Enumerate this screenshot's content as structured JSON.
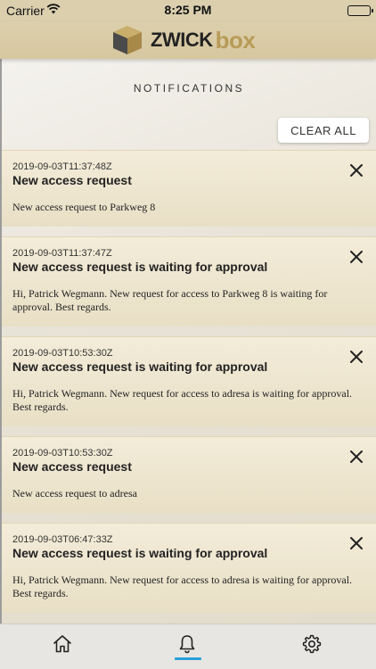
{
  "status_bar": {
    "carrier": "Carrier",
    "time": "8:25 PM",
    "battery_level": 1.0
  },
  "header": {
    "brand_left": "ZWICK",
    "brand_right": "box"
  },
  "page": {
    "title": "NOTIFICATIONS",
    "clear_all_label": "CLEAR ALL"
  },
  "notifications": [
    {
      "timestamp": "2019-09-03T11:37:48Z",
      "title": "New access request",
      "message": "New access request to Parkweg 8"
    },
    {
      "timestamp": "2019-09-03T11:37:47Z",
      "title": "New access request is waiting for approval",
      "message": "Hi, Patrick Wegmann. New request for access to Parkweg 8 is waiting for approval. Best regards."
    },
    {
      "timestamp": "2019-09-03T10:53:30Z",
      "title": "New access request is waiting for approval",
      "message": "Hi, Patrick Wegmann. New request for access to adresa is waiting for approval. Best regards."
    },
    {
      "timestamp": "2019-09-03T10:53:30Z",
      "title": "New access request",
      "message": "New access request to adresa"
    },
    {
      "timestamp": "2019-09-03T06:47:33Z",
      "title": "New access request is waiting for approval",
      "message": "Hi, Patrick Wegmann. New request for access to adresa is waiting for approval. Best regards."
    }
  ],
  "tabs": [
    {
      "icon": "home-icon"
    },
    {
      "icon": "bell-icon",
      "active": true
    },
    {
      "icon": "gear-icon"
    }
  ],
  "colors": {
    "accent": "#29a0d6",
    "brand_gold": "#b89b58",
    "header_bg": "#dccfac"
  }
}
